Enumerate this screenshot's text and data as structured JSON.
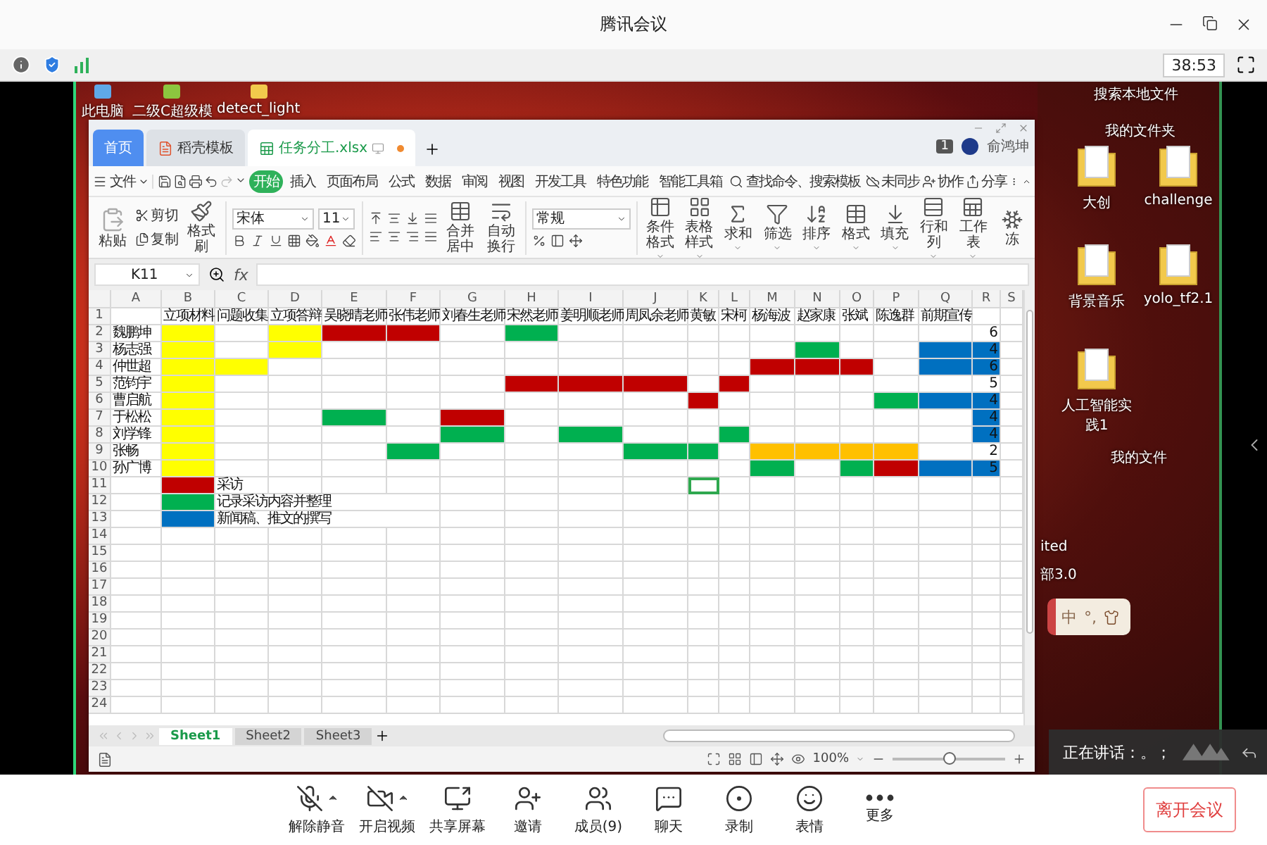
{
  "window": {
    "title": "腾讯会议"
  },
  "info_bar": {
    "timer": "38:53"
  },
  "desktop": {
    "icons": [
      {
        "label": "此电脑"
      },
      {
        "label": "二级C超级模"
      },
      {
        "label": "detect_light"
      }
    ],
    "side_panel": {
      "search": "搜索本地文件",
      "folder_title": "我的文件夹",
      "folders": [
        {
          "label": "大创"
        },
        {
          "label": "challenge"
        },
        {
          "label": "背景音乐"
        },
        {
          "label": "yolo_tf2.1"
        },
        {
          "label": "人工智能实践1"
        }
      ],
      "files_title": "我的文件",
      "files": [
        {
          "label": "ited"
        },
        {
          "label": "部3.0"
        }
      ]
    },
    "ime": {
      "mode": "中",
      "punct": "°,"
    }
  },
  "spreadsheet": {
    "tabs": [
      {
        "label": "首页",
        "kind": "home",
        "selected": false
      },
      {
        "label": "稻壳模板",
        "kind": "docer",
        "selected": false
      },
      {
        "label": "任务分工.xlsx",
        "kind": "sheet",
        "selected": true
      }
    ],
    "badge": "1",
    "user": "俞鸿坤",
    "menu": {
      "file": "文件",
      "items": [
        {
          "label": "开始",
          "selected": true
        },
        {
          "label": "插入",
          "selected": false
        },
        {
          "label": "页面布局",
          "selected": false
        },
        {
          "label": "公式",
          "selected": false
        },
        {
          "label": "数据",
          "selected": false
        },
        {
          "label": "审阅",
          "selected": false
        },
        {
          "label": "视图",
          "selected": false
        },
        {
          "label": "开发工具",
          "selected": false
        },
        {
          "label": "特色功能",
          "selected": false
        },
        {
          "label": "智能工具箱",
          "selected": false
        }
      ],
      "search": "查找命令、搜索模板",
      "sync": "未同步",
      "collab": "协作",
      "share": "分享"
    },
    "ribbon": {
      "paste": "粘贴",
      "cut": "剪切",
      "copy": "复制",
      "format_painter": "格式刷",
      "font": "宋体",
      "font_size": "11",
      "merge": "合并居中",
      "wrap": "自动换行",
      "number_format": "常规",
      "commands": [
        {
          "label": "条件格式",
          "kind": "conditional",
          "menu": true
        },
        {
          "label": "表格样式",
          "kind": "table_style",
          "menu": true
        },
        {
          "label": "求和",
          "kind": "sum",
          "menu": true
        },
        {
          "label": "筛选",
          "kind": "filter",
          "menu": true
        },
        {
          "label": "排序",
          "kind": "sort",
          "menu": true
        },
        {
          "label": "格式",
          "kind": "format",
          "menu": true
        },
        {
          "label": "填充",
          "kind": "fill",
          "menu": true
        },
        {
          "label": "行和列",
          "kind": "rows_cols",
          "menu": true
        },
        {
          "label": "工作表",
          "kind": "sheet",
          "menu": true
        },
        {
          "label": "冻",
          "kind": "freeze"
        }
      ]
    },
    "name_box": "K11",
    "fx_label": "fx",
    "grid": {
      "columns": [
        "A",
        "B",
        "C",
        "D",
        "E",
        "F",
        "G",
        "H",
        "I",
        "J",
        "K",
        "L",
        "M",
        "N",
        "O",
        "P",
        "Q",
        "R",
        "S"
      ],
      "rows": [
        {
          "number": "1",
          "cells": [
            {},
            {
              "text": "立项材料"
            },
            {
              "text": "问题收集"
            },
            {
              "text": "立项答辩"
            },
            {
              "text": "吴晓晴老师"
            },
            {
              "text": "张伟老师"
            },
            {
              "text": "刘春生老师"
            },
            {
              "text": "宋然老师"
            },
            {
              "text": "姜明顺老师"
            },
            {
              "text": "周凤余老师"
            },
            {
              "text": "黄敏"
            },
            {
              "text": "宋柯"
            },
            {
              "text": "杨海波"
            },
            {
              "text": "赵家康"
            },
            {
              "text": "张斌"
            },
            {
              "text": "陈逸群"
            },
            {
              "text": "前期宣传"
            },
            {},
            {}
          ]
        },
        {
          "number": "2",
          "cells": [
            {
              "text": "魏鹏坤"
            },
            {
              "color": "#ffff00"
            },
            {},
            {
              "color": "#ffff00"
            },
            {
              "color": "#c00000"
            },
            {
              "color": "#c00000"
            },
            {},
            {
              "color": "#00b050"
            },
            {},
            {},
            {},
            {},
            {},
            {},
            {},
            {},
            {},
            {
              "text": "6",
              "kind": "number"
            },
            {}
          ]
        },
        {
          "number": "3",
          "cells": [
            {
              "text": "杨志强"
            },
            {
              "color": "#ffff00"
            },
            {},
            {
              "color": "#ffff00"
            },
            {},
            {},
            {},
            {},
            {},
            {},
            {},
            {},
            {},
            {
              "color": "#00b050"
            },
            {},
            {},
            {
              "color": "#0070c0"
            },
            {
              "text": "4",
              "kind": "number",
              "color": "#0070c0"
            },
            {}
          ]
        },
        {
          "number": "4",
          "cells": [
            {
              "text": "仲世超"
            },
            {
              "color": "#ffff00"
            },
            {
              "color": "#ffff00"
            },
            {},
            {},
            {},
            {},
            {},
            {},
            {},
            {},
            {},
            {
              "color": "#c00000"
            },
            {
              "color": "#c00000"
            },
            {
              "color": "#c00000"
            },
            {},
            {
              "color": "#0070c0"
            },
            {
              "text": "6",
              "kind": "number",
              "color": "#0070c0"
            },
            {}
          ]
        },
        {
          "number": "5",
          "cells": [
            {
              "text": "范钧宇"
            },
            {
              "color": "#ffff00"
            },
            {},
            {},
            {},
            {},
            {},
            {
              "color": "#c00000"
            },
            {
              "color": "#c00000"
            },
            {
              "color": "#c00000"
            },
            {},
            {
              "color": "#c00000"
            },
            {},
            {},
            {},
            {},
            {},
            {
              "text": "5",
              "kind": "number"
            },
            {}
          ]
        },
        {
          "number": "6",
          "cells": [
            {
              "text": "曹启航"
            },
            {
              "color": "#ffff00"
            },
            {},
            {},
            {},
            {},
            {},
            {},
            {},
            {},
            {
              "color": "#c00000"
            },
            {},
            {},
            {},
            {},
            {
              "color": "#00b050"
            },
            {
              "color": "#0070c0"
            },
            {
              "text": "4",
              "kind": "number",
              "color": "#0070c0"
            },
            {}
          ]
        },
        {
          "number": "7",
          "cells": [
            {
              "text": "于松松"
            },
            {
              "color": "#ffff00"
            },
            {},
            {},
            {
              "color": "#00b050"
            },
            {},
            {
              "color": "#c00000"
            },
            {},
            {},
            {},
            {},
            {},
            {},
            {},
            {},
            {},
            {},
            {
              "text": "4",
              "kind": "number",
              "color": "#0070c0"
            },
            {}
          ]
        },
        {
          "number": "8",
          "cells": [
            {
              "text": "刘学锋"
            },
            {
              "color": "#ffff00"
            },
            {},
            {},
            {},
            {},
            {
              "color": "#00b050"
            },
            {},
            {
              "color": "#00b050"
            },
            {},
            {},
            {
              "color": "#00b050"
            },
            {},
            {},
            {},
            {},
            {},
            {
              "text": "4",
              "kind": "number",
              "color": "#0070c0"
            },
            {}
          ]
        },
        {
          "number": "9",
          "cells": [
            {
              "text": "张畅"
            },
            {
              "color": "#ffff00"
            },
            {},
            {},
            {},
            {
              "color": "#00b050"
            },
            {},
            {},
            {},
            {
              "color": "#00b050"
            },
            {
              "color": "#00b050"
            },
            {},
            {
              "color": "#ffc000"
            },
            {
              "color": "#ffc000"
            },
            {
              "color": "#ffc000"
            },
            {
              "color": "#ffc000"
            },
            {},
            {
              "text": "2",
              "kind": "number"
            },
            {}
          ]
        },
        {
          "number": "10",
          "cells": [
            {
              "text": "孙广博"
            },
            {
              "color": "#ffff00"
            },
            {},
            {},
            {},
            {},
            {},
            {},
            {},
            {},
            {},
            {},
            {
              "color": "#00b050"
            },
            {},
            {
              "color": "#00b050"
            },
            {
              "color": "#c00000"
            },
            {
              "color": "#0070c0"
            },
            {
              "text": "5",
              "kind": "number",
              "color": "#0070c0"
            },
            {}
          ]
        },
        {
          "number": "11",
          "cells": [
            {},
            {
              "color": "#c00000"
            },
            {
              "text": "采访"
            },
            {},
            {},
            {},
            {},
            {},
            {},
            {},
            {
              "selected": true
            },
            {},
            {},
            {},
            {},
            {},
            {},
            {},
            {}
          ]
        },
        {
          "number": "12",
          "cells": [
            {},
            {
              "color": "#00b050"
            },
            {
              "text": "记录采访内容并整理"
            },
            {},
            {},
            {},
            {},
            {},
            {},
            {},
            {},
            {},
            {},
            {},
            {},
            {},
            {},
            {},
            {}
          ]
        },
        {
          "number": "13",
          "cells": [
            {},
            {
              "color": "#0070c0"
            },
            {
              "text": "新闻稿、推文的撰写"
            },
            {},
            {},
            {},
            {},
            {},
            {},
            {},
            {},
            {},
            {},
            {},
            {},
            {},
            {},
            {},
            {}
          ]
        }
      ],
      "empty_rows": [
        "14",
        "15",
        "16",
        "17",
        "18",
        "19",
        "20",
        "21",
        "22",
        "23",
        "24"
      ]
    },
    "sheets": [
      {
        "label": "Sheet1",
        "selected": true
      },
      {
        "label": "Sheet2",
        "selected": false
      },
      {
        "label": "Sheet3",
        "selected": false
      }
    ],
    "zoom": "100%",
    "zoom_slider": {
      "level": 0.5
    }
  },
  "speaking": "正在讲话：。；",
  "toolbar": {
    "buttons": [
      {
        "label": "解除静音",
        "kind": "mic_off",
        "menu": true
      },
      {
        "label": "开启视频",
        "kind": "video_off",
        "menu": true
      },
      {
        "label": "共享屏幕",
        "kind": "share"
      },
      {
        "label": "邀请",
        "kind": "invite"
      },
      {
        "label": "成员(9)",
        "kind": "members"
      },
      {
        "label": "聊天",
        "kind": "chat"
      },
      {
        "label": "录制",
        "kind": "record"
      },
      {
        "label": "表情",
        "kind": "emoji"
      },
      {
        "label": "更多",
        "kind": "more"
      }
    ],
    "leave": "离开会议"
  }
}
